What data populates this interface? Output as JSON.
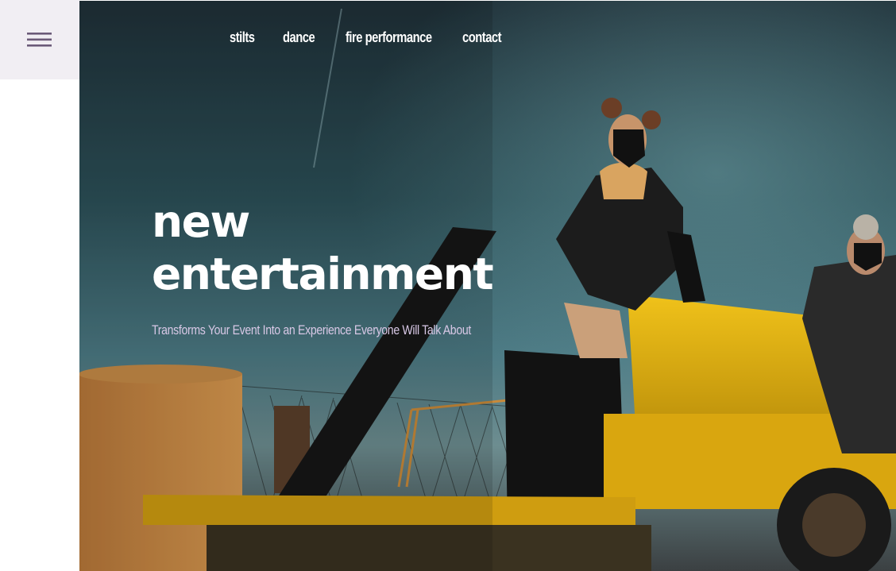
{
  "menu": {
    "icon": "hamburger-menu-icon"
  },
  "nav": {
    "items": [
      {
        "label": "stilts"
      },
      {
        "label": "dance"
      },
      {
        "label": "fire performance"
      },
      {
        "label": "contact"
      }
    ]
  },
  "hero": {
    "headline_line1": "new",
    "headline_line2": "entertainment",
    "tagline": "Transforms Your Event Into an Experience Everyone Will Talk About"
  },
  "colors": {
    "menu_bg": "#f1eef3",
    "menu_icon": "#6b5a78",
    "tagline": "#d8c8e6",
    "text": "#ffffff",
    "machinery_yellow": "#e2b20f"
  }
}
